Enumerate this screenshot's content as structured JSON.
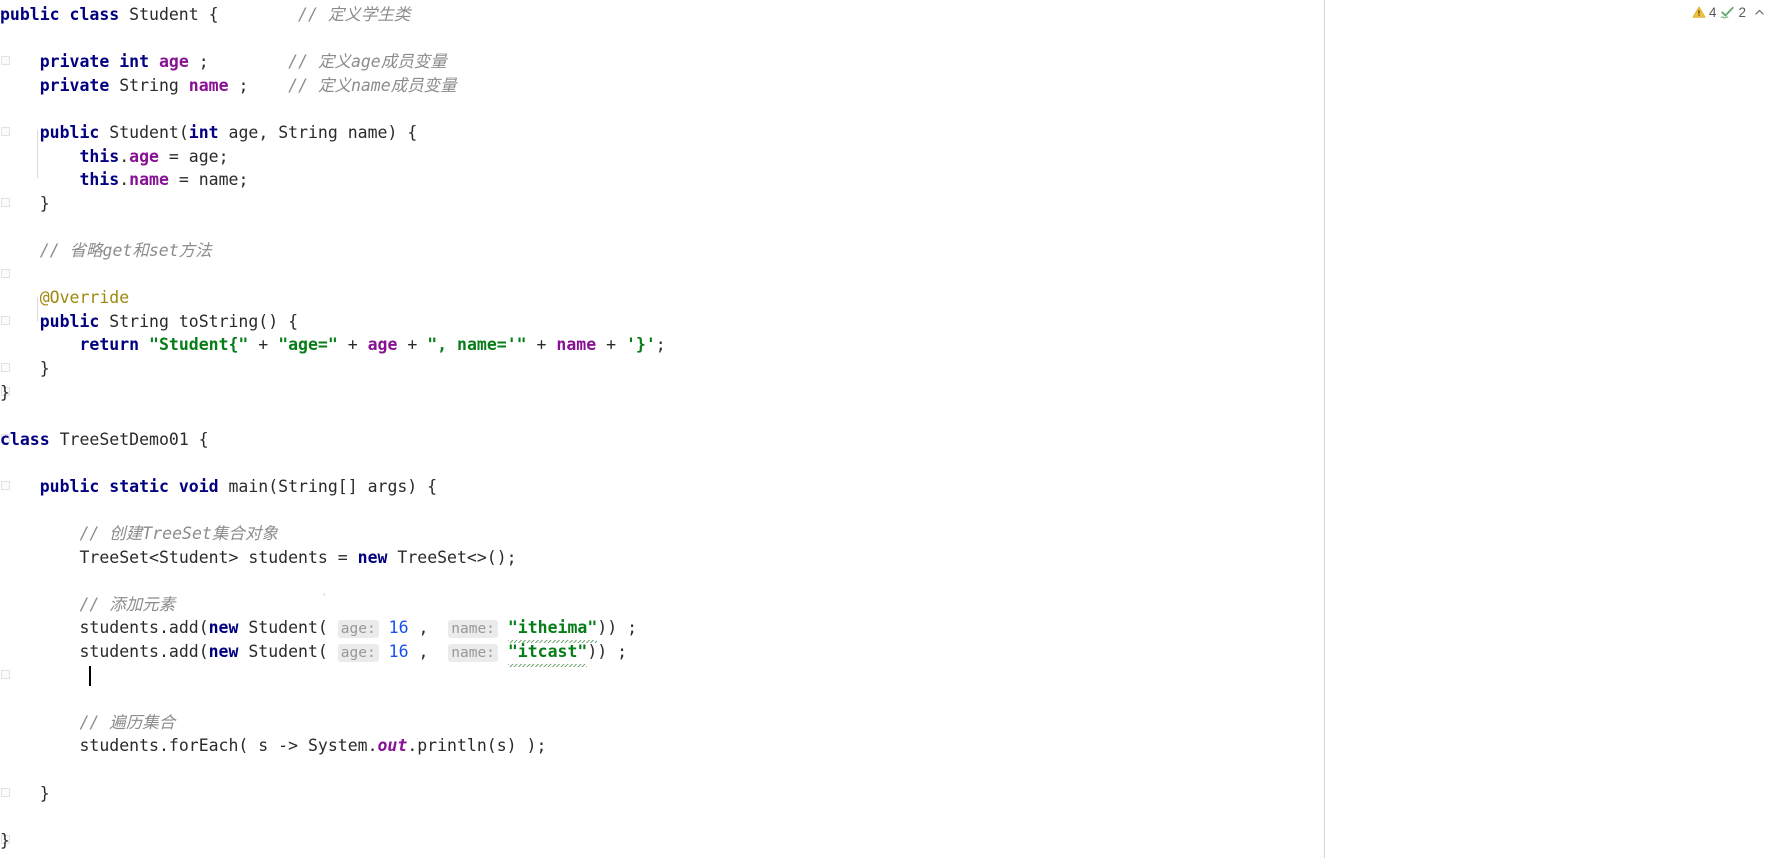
{
  "app": {
    "type": "java-code-editor",
    "theme": "light"
  },
  "colors": {
    "background": "#ffffff",
    "keyword": "#000080",
    "field": "#871094",
    "string": "#067d17",
    "number": "#1750eb",
    "comment": "#8c8c8c",
    "annotation": "#9e880d",
    "plain": "#2a2a2a",
    "hint_background": "#ebebeb",
    "hint_text": "#989898",
    "divider": "#d6d6d6",
    "warning_icon": "#f0c040",
    "typo_icon": "#59a869"
  },
  "inspection_widget": {
    "warning": {
      "icon": "warning-triangle-icon",
      "count": "4"
    },
    "typo": {
      "icon": "typo-check-icon",
      "count": "2"
    },
    "collapse": {
      "icon": "chevron-up-icon",
      "label": "^"
    }
  },
  "code": {
    "language": "Java",
    "lines": [
      {
        "n": 1,
        "tokens": [
          {
            "t": "kw",
            "v": "public class "
          },
          {
            "t": "plain",
            "v": "Student {"
          },
          {
            "t": "plain",
            "v": "        "
          },
          {
            "t": "cmt",
            "v": "// 定义学生类"
          }
        ]
      },
      {
        "n": 2,
        "tokens": []
      },
      {
        "n": 3,
        "tokens": [
          {
            "t": "plain",
            "v": "    "
          },
          {
            "t": "kw",
            "v": "private int "
          },
          {
            "t": "field",
            "v": "age "
          },
          {
            "t": "plain",
            "v": ";"
          },
          {
            "t": "plain",
            "v": "        "
          },
          {
            "t": "cmt",
            "v": "// 定义age成员变量"
          }
        ]
      },
      {
        "n": 4,
        "tokens": [
          {
            "t": "plain",
            "v": "    "
          },
          {
            "t": "kw",
            "v": "private "
          },
          {
            "t": "plain",
            "v": "String "
          },
          {
            "t": "field",
            "v": "name "
          },
          {
            "t": "plain",
            "v": ";"
          },
          {
            "t": "plain",
            "v": "    "
          },
          {
            "t": "cmt",
            "v": "// 定义name成员变量"
          }
        ]
      },
      {
        "n": 5,
        "tokens": []
      },
      {
        "n": 6,
        "tokens": [
          {
            "t": "plain",
            "v": "    "
          },
          {
            "t": "kw",
            "v": "public "
          },
          {
            "t": "plain",
            "v": "Student("
          },
          {
            "t": "kw",
            "v": "int "
          },
          {
            "t": "plain",
            "v": "age, String name) {"
          }
        ]
      },
      {
        "n": 7,
        "tokens": [
          {
            "t": "plain",
            "v": "        "
          },
          {
            "t": "kw",
            "v": "this"
          },
          {
            "t": "plain",
            "v": "."
          },
          {
            "t": "field",
            "v": "age"
          },
          {
            "t": "plain",
            "v": " = age;"
          }
        ]
      },
      {
        "n": 8,
        "tokens": [
          {
            "t": "plain",
            "v": "        "
          },
          {
            "t": "kw",
            "v": "this"
          },
          {
            "t": "plain",
            "v": "."
          },
          {
            "t": "field",
            "v": "name"
          },
          {
            "t": "plain",
            "v": " = name;"
          }
        ]
      },
      {
        "n": 9,
        "tokens": [
          {
            "t": "plain",
            "v": "    }"
          }
        ]
      },
      {
        "n": 10,
        "tokens": []
      },
      {
        "n": 11,
        "tokens": [
          {
            "t": "plain",
            "v": "    "
          },
          {
            "t": "cmt",
            "v": "// 省略get和set方法"
          }
        ]
      },
      {
        "n": 12,
        "tokens": []
      },
      {
        "n": 13,
        "tokens": [
          {
            "t": "plain",
            "v": "    "
          },
          {
            "t": "anno",
            "v": "@Override"
          }
        ]
      },
      {
        "n": 14,
        "tokens": [
          {
            "t": "plain",
            "v": "    "
          },
          {
            "t": "kw",
            "v": "public "
          },
          {
            "t": "plain",
            "v": "String toString() {"
          }
        ]
      },
      {
        "n": 15,
        "tokens": [
          {
            "t": "plain",
            "v": "        "
          },
          {
            "t": "kw",
            "v": "return "
          },
          {
            "t": "str",
            "v": "\"Student{\""
          },
          {
            "t": "plain",
            "v": " + "
          },
          {
            "t": "str",
            "v": "\"age=\""
          },
          {
            "t": "plain",
            "v": " + "
          },
          {
            "t": "field",
            "v": "age"
          },
          {
            "t": "plain",
            "v": " + "
          },
          {
            "t": "str",
            "v": "\", name='\""
          },
          {
            "t": "plain",
            "v": " + "
          },
          {
            "t": "field",
            "v": "name"
          },
          {
            "t": "plain",
            "v": " + "
          },
          {
            "t": "str",
            "v": "'}'"
          },
          {
            "t": "plain",
            "v": ";"
          }
        ]
      },
      {
        "n": 16,
        "tokens": [
          {
            "t": "plain",
            "v": "    }"
          }
        ]
      },
      {
        "n": 17,
        "tokens": [
          {
            "t": "plain",
            "v": "}"
          }
        ]
      },
      {
        "n": 18,
        "tokens": []
      },
      {
        "n": 19,
        "tokens": [
          {
            "t": "kw",
            "v": "class "
          },
          {
            "t": "plain",
            "v": "TreeSetDemo01 {"
          }
        ]
      },
      {
        "n": 20,
        "tokens": []
      },
      {
        "n": 21,
        "tokens": [
          {
            "t": "plain",
            "v": "    "
          },
          {
            "t": "kw",
            "v": "public static void "
          },
          {
            "t": "plain",
            "v": "main(String[] args) {"
          }
        ]
      },
      {
        "n": 22,
        "tokens": []
      },
      {
        "n": 23,
        "tokens": [
          {
            "t": "plain",
            "v": "        "
          },
          {
            "t": "cmt",
            "v": "// 创建TreeSet集合对象"
          }
        ]
      },
      {
        "n": 24,
        "tokens": [
          {
            "t": "plain",
            "v": "        "
          },
          {
            "t": "plain",
            "v": "TreeSet<Student> students = "
          },
          {
            "t": "kw",
            "v": "new "
          },
          {
            "t": "plain",
            "v": "TreeSet<>();"
          }
        ]
      },
      {
        "n": 25,
        "tokens": []
      },
      {
        "n": 26,
        "tokens": [
          {
            "t": "plain",
            "v": "        "
          },
          {
            "t": "cmt",
            "v": "// 添加元素"
          }
        ]
      },
      {
        "n": 27,
        "tokens": [
          {
            "t": "plain",
            "v": "        "
          },
          {
            "t": "plain",
            "v": "students.add("
          },
          {
            "t": "kw",
            "v": "new "
          },
          {
            "t": "plain",
            "v": "Student( "
          },
          {
            "t": "hint",
            "v": "age:"
          },
          {
            "t": "num",
            "v": " 16 "
          },
          {
            "t": "plain",
            "v": ",  "
          },
          {
            "t": "hint",
            "v": "name:"
          },
          {
            "t": "plain",
            "v": " "
          },
          {
            "t": "strtypo",
            "v": "\"itheima\""
          },
          {
            "t": "plain",
            "v": ")) ;"
          }
        ]
      },
      {
        "n": 28,
        "tokens": [
          {
            "t": "plain",
            "v": "        "
          },
          {
            "t": "plain",
            "v": "students.add("
          },
          {
            "t": "kw",
            "v": "new "
          },
          {
            "t": "plain",
            "v": "Student( "
          },
          {
            "t": "hint",
            "v": "age:"
          },
          {
            "t": "num",
            "v": " 16 "
          },
          {
            "t": "plain",
            "v": ",  "
          },
          {
            "t": "hint",
            "v": "name:"
          },
          {
            "t": "plain",
            "v": " "
          },
          {
            "t": "strtypo",
            "v": "\"itcast\""
          },
          {
            "t": "plain",
            "v": ")) ;"
          }
        ]
      },
      {
        "n": 29,
        "tokens": [
          {
            "t": "plain",
            "v": "         "
          }
        ]
      },
      {
        "n": 30,
        "tokens": []
      },
      {
        "n": 31,
        "tokens": [
          {
            "t": "plain",
            "v": "        "
          },
          {
            "t": "cmt",
            "v": "// 遍历集合"
          }
        ]
      },
      {
        "n": 32,
        "tokens": [
          {
            "t": "plain",
            "v": "        "
          },
          {
            "t": "plain",
            "v": "students.forEach( s -> System."
          },
          {
            "t": "fieldi",
            "v": "out"
          },
          {
            "t": "plain",
            "v": ".println(s) );"
          }
        ]
      },
      {
        "n": 33,
        "tokens": []
      },
      {
        "n": 34,
        "tokens": [
          {
            "t": "plain",
            "v": "    }"
          }
        ]
      },
      {
        "n": 35,
        "tokens": []
      },
      {
        "n": 36,
        "tokens": [
          {
            "t": "plain",
            "v": "}"
          }
        ]
      }
    ]
  },
  "gutter": {
    "fold_marker_lines": [
      3,
      6,
      9,
      12,
      14,
      16,
      17,
      19,
      21,
      29,
      34,
      36
    ]
  },
  "caret": {
    "line": 29,
    "column": 9
  }
}
